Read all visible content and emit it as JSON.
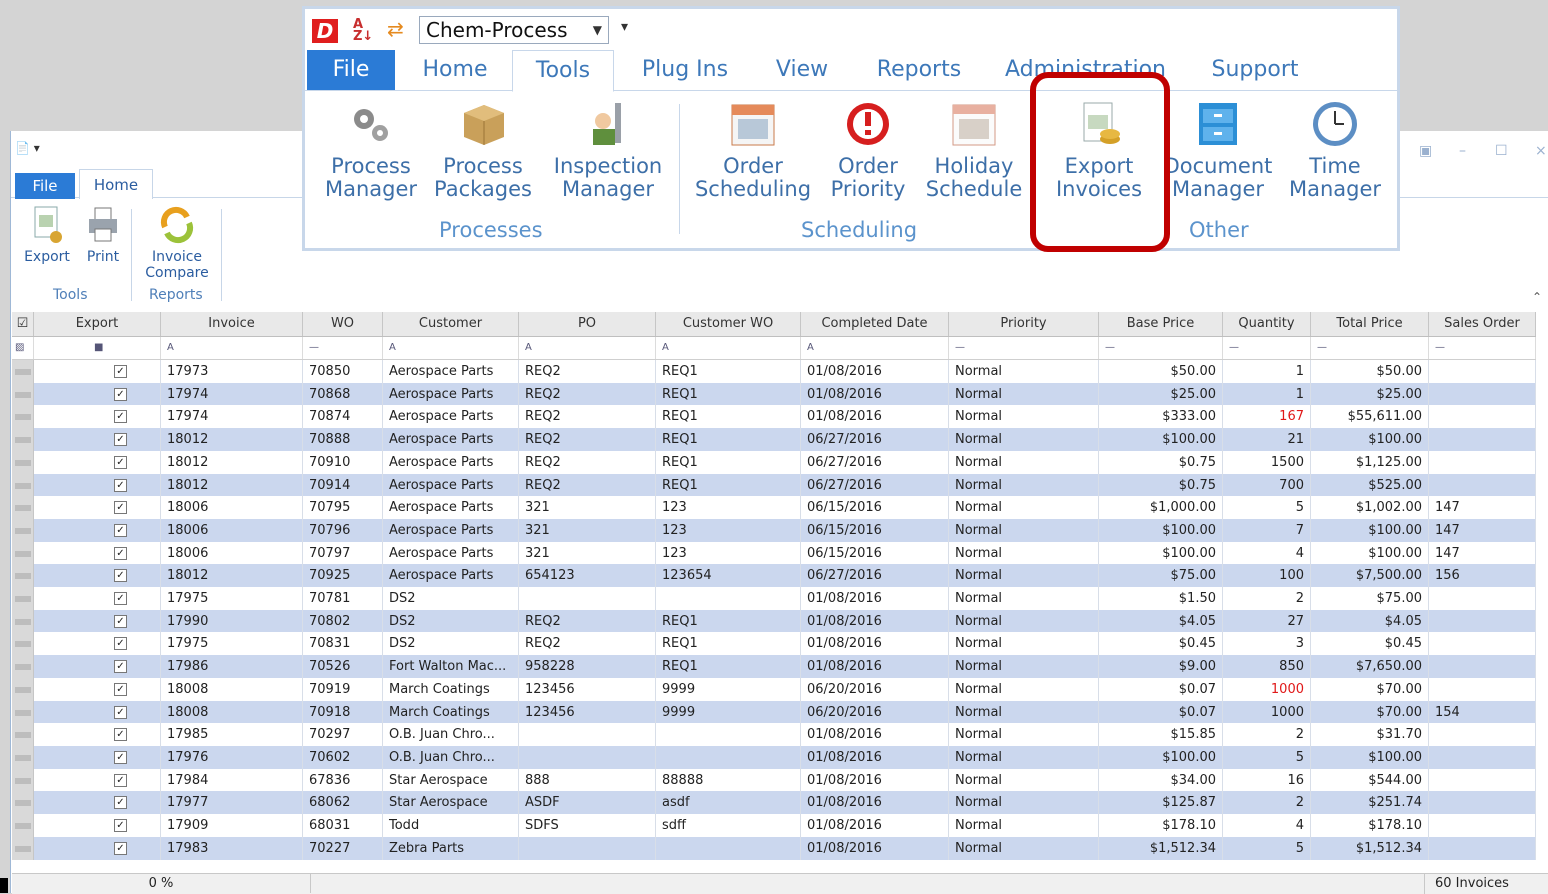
{
  "front_ribbon": {
    "combo_value": "Chem-Process",
    "tabs": [
      "File",
      "Home",
      "Tools",
      "Plug Ins",
      "View",
      "Reports",
      "Administration",
      "Support"
    ],
    "buttons": {
      "process_manager": [
        "Process",
        "Manager"
      ],
      "process_packages": [
        "Process",
        "Packages"
      ],
      "inspection_manager": [
        "Inspection",
        "Manager"
      ],
      "order_scheduling": [
        "Order",
        "Scheduling"
      ],
      "order_priority": [
        "Order",
        "Priority"
      ],
      "holiday_schedule": [
        "Holiday",
        "Schedule"
      ],
      "export_invoices": [
        "Export",
        "Invoices"
      ],
      "document_manager": [
        "Document",
        "Manager"
      ],
      "time_manager": [
        "Time",
        "Manager"
      ]
    },
    "groups": {
      "processes": "Processes",
      "scheduling": "Scheduling",
      "other": "Other"
    }
  },
  "back_ribbon": {
    "file_tab": "File",
    "home_tab": "Home",
    "export": "Export",
    "print": "Print",
    "invoice_compare": [
      "Invoice",
      "Compare"
    ],
    "group_tools": "Tools",
    "group_reports": "Reports"
  },
  "grid": {
    "columns": [
      "Export",
      "Invoice",
      "WO",
      "Customer",
      "PO",
      "Customer WO",
      "Completed Date",
      "Priority",
      "Base Price",
      "Quantity",
      "Total Price",
      "Sales Order"
    ],
    "rows": [
      [
        "17973",
        "70850",
        "Aerospace Parts",
        "REQ2",
        "REQ1",
        "01/08/2016",
        "Normal",
        "$50.00",
        "1",
        "$50.00",
        ""
      ],
      [
        "17974",
        "70868",
        "Aerospace Parts",
        "REQ2",
        "REQ1",
        "01/08/2016",
        "Normal",
        "$25.00",
        "1",
        "$25.00",
        ""
      ],
      [
        "17974",
        "70874",
        "Aerospace Parts",
        "REQ2",
        "REQ1",
        "01/08/2016",
        "Normal",
        "$333.00",
        "167",
        "$55,611.00",
        ""
      ],
      [
        "18012",
        "70888",
        "Aerospace Parts",
        "REQ2",
        "REQ1",
        "06/27/2016",
        "Normal",
        "$100.00",
        "21",
        "$100.00",
        ""
      ],
      [
        "18012",
        "70910",
        "Aerospace Parts",
        "REQ2",
        "REQ1",
        "06/27/2016",
        "Normal",
        "$0.75",
        "1500",
        "$1,125.00",
        ""
      ],
      [
        "18012",
        "70914",
        "Aerospace Parts",
        "REQ2",
        "REQ1",
        "06/27/2016",
        "Normal",
        "$0.75",
        "700",
        "$525.00",
        ""
      ],
      [
        "18006",
        "70795",
        "Aerospace Parts",
        "321",
        "123",
        "06/15/2016",
        "Normal",
        "$1,000.00",
        "5",
        "$1,002.00",
        "147"
      ],
      [
        "18006",
        "70796",
        "Aerospace Parts",
        "321",
        "123",
        "06/15/2016",
        "Normal",
        "$100.00",
        "7",
        "$100.00",
        "147"
      ],
      [
        "18006",
        "70797",
        "Aerospace Parts",
        "321",
        "123",
        "06/15/2016",
        "Normal",
        "$100.00",
        "4",
        "$100.00",
        "147"
      ],
      [
        "18012",
        "70925",
        "Aerospace Parts",
        "654123",
        "123654",
        "06/27/2016",
        "Normal",
        "$75.00",
        "100",
        "$7,500.00",
        "156"
      ],
      [
        "17975",
        "70781",
        "DS2",
        "",
        "",
        "01/08/2016",
        "Normal",
        "$1.50",
        "2",
        "$75.00",
        ""
      ],
      [
        "17990",
        "70802",
        "DS2",
        "REQ2",
        "REQ1",
        "01/08/2016",
        "Normal",
        "$4.05",
        "27",
        "$4.05",
        ""
      ],
      [
        "17975",
        "70831",
        "DS2",
        "REQ2",
        "REQ1",
        "01/08/2016",
        "Normal",
        "$0.45",
        "3",
        "$0.45",
        ""
      ],
      [
        "17986",
        "70526",
        "Fort Walton Mac...",
        "958228",
        "REQ1",
        "01/08/2016",
        "Normal",
        "$9.00",
        "850",
        "$7,650.00",
        ""
      ],
      [
        "18008",
        "70919",
        "March Coatings",
        "123456",
        "9999",
        "06/20/2016",
        "Normal",
        "$0.07",
        "1000",
        "$70.00",
        ""
      ],
      [
        "18008",
        "70918",
        "March Coatings",
        "123456",
        "9999",
        "06/20/2016",
        "Normal",
        "$0.07",
        "1000",
        "$70.00",
        "154"
      ],
      [
        "17985",
        "70297",
        "O.B. Juan Chro...",
        "",
        "",
        "01/08/2016",
        "Normal",
        "$15.85",
        "2",
        "$31.70",
        ""
      ],
      [
        "17976",
        "70602",
        "O.B. Juan Chro...",
        "",
        "",
        "01/08/2016",
        "Normal",
        "$100.00",
        "5",
        "$100.00",
        ""
      ],
      [
        "17984",
        "67836",
        "Star Aerospace",
        "888",
        "88888",
        "01/08/2016",
        "Normal",
        "$34.00",
        "16",
        "$544.00",
        ""
      ],
      [
        "17977",
        "68062",
        "Star Aerospace",
        "ASDF",
        "asdf",
        "01/08/2016",
        "Normal",
        "$125.87",
        "2",
        "$251.74",
        ""
      ],
      [
        "17909",
        "68031",
        "Todd",
        "SDFS",
        "sdff",
        "01/08/2016",
        "Normal",
        "$178.10",
        "4",
        "$178.10",
        ""
      ],
      [
        "17983",
        "70227",
        "Zebra Parts",
        "",
        "",
        "01/08/2016",
        "Normal",
        "$1,512.34",
        "5",
        "$1,512.34",
        ""
      ]
    ],
    "red_quantity_rows": [
      2,
      14
    ]
  },
  "status": {
    "progress": "0 %",
    "count": "60 Invoices"
  },
  "colors": {
    "accent": "#2b7bd6",
    "highlight": "#c00000",
    "alt_row": "#cbd7ee",
    "warning_qty": "#e01818"
  }
}
